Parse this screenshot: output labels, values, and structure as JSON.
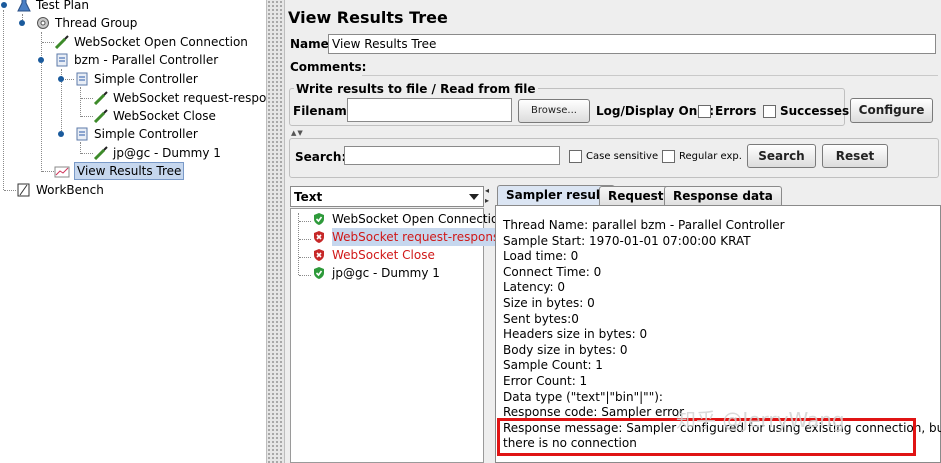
{
  "tree": {
    "items": [
      {
        "label": "Test Plan"
      },
      {
        "label": "Thread Group"
      },
      {
        "label": "WebSocket Open Connection"
      },
      {
        "label": "bzm - Parallel Controller"
      },
      {
        "label": "Simple Controller"
      },
      {
        "label": "WebSocket request-respons"
      },
      {
        "label": "WebSocket Close"
      },
      {
        "label": "Simple Controller"
      },
      {
        "label": "jp@gc - Dummy 1"
      },
      {
        "label": "View Results Tree"
      },
      {
        "label": "WorkBench"
      }
    ]
  },
  "panel": {
    "title": "View Results Tree",
    "name_label": "Name:",
    "name_value": "View Results Tree",
    "comments_label": "Comments:",
    "write_section_title": "Write results to file / Read from file",
    "filename_label": "Filename",
    "filename_value": "",
    "browse_label": "Browse...",
    "log_display_label": "Log/Display Only:",
    "errors_label": "Errors",
    "successes_label": "Successes",
    "configure_label": "Configure"
  },
  "search": {
    "label": "Search:",
    "value": "",
    "case_sensitive_label": "Case sensitive",
    "regex_label": "Regular exp.",
    "search_button": "Search",
    "reset_button": "Reset"
  },
  "renderer": {
    "selected": "Text"
  },
  "results": [
    {
      "label": "WebSocket Open Connectio",
      "status": "ok"
    },
    {
      "label": "WebSocket request-respons",
      "status": "error"
    },
    {
      "label": "WebSocket Close",
      "status": "error"
    },
    {
      "label": "jp@gc - Dummy 1",
      "status": "ok"
    }
  ],
  "tabs": [
    {
      "label": "Sampler result"
    },
    {
      "label": "Request"
    },
    {
      "label": "Response data"
    }
  ],
  "sampler_result": [
    "Thread Name: parallel bzm - Parallel Controller",
    "Sample Start: 1970-01-01 07:00:00 KRAT",
    "Load time: 0",
    "Connect Time: 0",
    "Latency: 0",
    "Size in bytes: 0",
    "Sent bytes:0",
    "Headers size in bytes: 0",
    "Body size in bytes: 0",
    "Sample Count: 1",
    "Error Count: 1",
    "Data type (\"text\"|\"bin\"|\"\"):",
    "Response code: Sampler error",
    "Response message: Sampler configured for using existing connection, but",
    "there is no connection"
  ],
  "watermark": "知乎 @JerryWang",
  "colors": {
    "error_text": "#d01818",
    "highlight_border": "#e01414",
    "selection": "#c6d7ee"
  }
}
